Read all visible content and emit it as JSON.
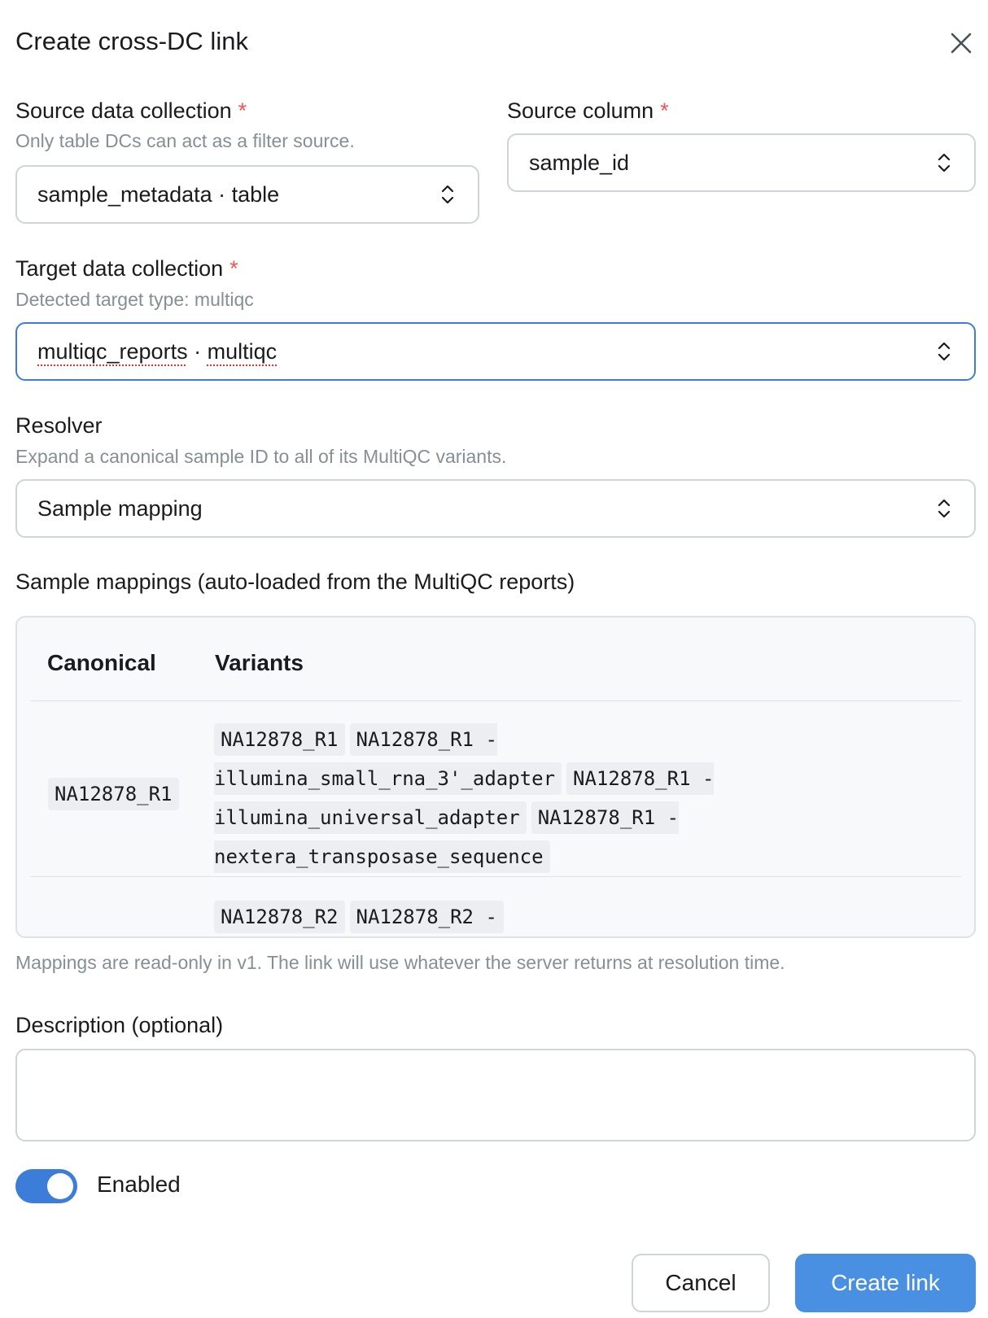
{
  "dialog": {
    "title": "Create cross-DC link"
  },
  "source_dc": {
    "label": "Source data collection",
    "required_mark": "*",
    "hint": "Only table DCs can act as a filter source.",
    "value": "sample_metadata · table"
  },
  "source_column": {
    "label": "Source column",
    "required_mark": "*",
    "value": "sample_id"
  },
  "target_dc": {
    "label": "Target data collection",
    "required_mark": "*",
    "hint": "Detected target type: multiqc",
    "value_part1": "multiqc_reports",
    "value_sep": " · ",
    "value_part2": "multiqc"
  },
  "resolver": {
    "label": "Resolver",
    "hint": "Expand a canonical sample ID to all of its MultiQC variants.",
    "value": "Sample mapping"
  },
  "mappings": {
    "label": "Sample mappings (auto-loaded from the MultiQC reports)",
    "col_canonical": "Canonical",
    "col_variants": "Variants",
    "rows": [
      {
        "canonical": "NA12878_R1",
        "variants": [
          "NA12878_R1",
          "NA12878_R1 -\nillumina_small_rna_3'_adapter",
          "NA12878_R1 -\nillumina_universal_adapter",
          "NA12878_R1 -\nnextera_transposase_sequence"
        ]
      },
      {
        "canonical": "",
        "variants": [
          "NA12878_R2",
          "NA12878_R2 -"
        ]
      }
    ],
    "note": "Mappings are read-only in v1. The link will use whatever the server returns at resolution time."
  },
  "description": {
    "label": "Description (optional)",
    "value": ""
  },
  "enabled": {
    "label": "Enabled",
    "checked": true
  },
  "actions": {
    "cancel": "Cancel",
    "create": "Create link"
  },
  "colors": {
    "accent": "#4a90e2",
    "required": "#fa5252",
    "hint": "#868e96",
    "focus_border": "#3b7dd8"
  }
}
